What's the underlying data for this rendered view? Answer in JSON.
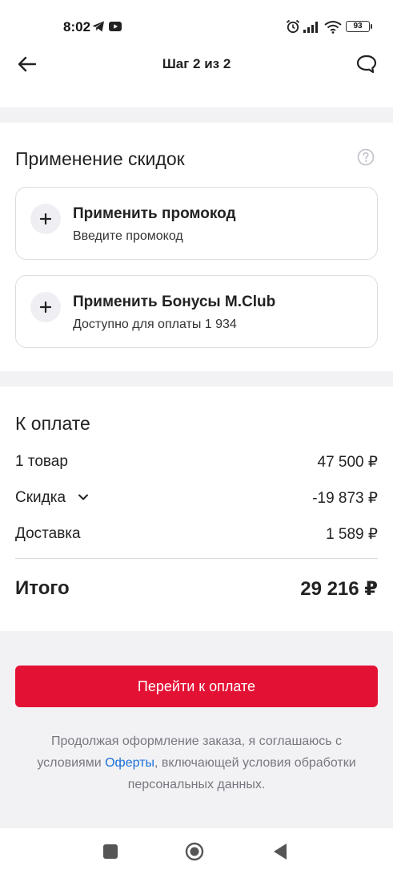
{
  "status_bar": {
    "time": "8:02",
    "battery": "93",
    "icons": [
      "telegram-icon",
      "youtube-icon",
      "alarm-icon",
      "signal-icon",
      "wifi-icon",
      "battery-icon"
    ]
  },
  "header": {
    "title": "Шаг 2 из 2",
    "back_icon": "arrow-left-icon",
    "chat_icon": "chat-bubble-icon"
  },
  "discounts": {
    "title": "Применение скидок",
    "help_icon": "question-circle-icon",
    "promo": {
      "title": "Применить промокод",
      "subtitle": "Введите промокод"
    },
    "bonus": {
      "title": "Применить Бонусы M.Club",
      "subtitle": "Доступно для оплаты 1 934"
    }
  },
  "payment": {
    "title": "К оплате",
    "rows": [
      {
        "label": "1 товар",
        "value": "47 500 ₽"
      },
      {
        "label": "Скидка",
        "value": "-19 873 ₽"
      },
      {
        "label": "Доставка",
        "value": "1 589 ₽"
      }
    ],
    "total_label": "Итого",
    "total_value": "29 216 ₽"
  },
  "checkout": {
    "button_label": "Перейти к оплате",
    "legal_before": "Продолжая оформление заказа, я соглашаюсь с условиями ",
    "legal_link": "Оферты",
    "legal_after": ", включающей условия обработки персональных данных."
  },
  "colors": {
    "accent": "#e31235",
    "link": "#1a6fd6",
    "band": "#f2f2f5"
  }
}
